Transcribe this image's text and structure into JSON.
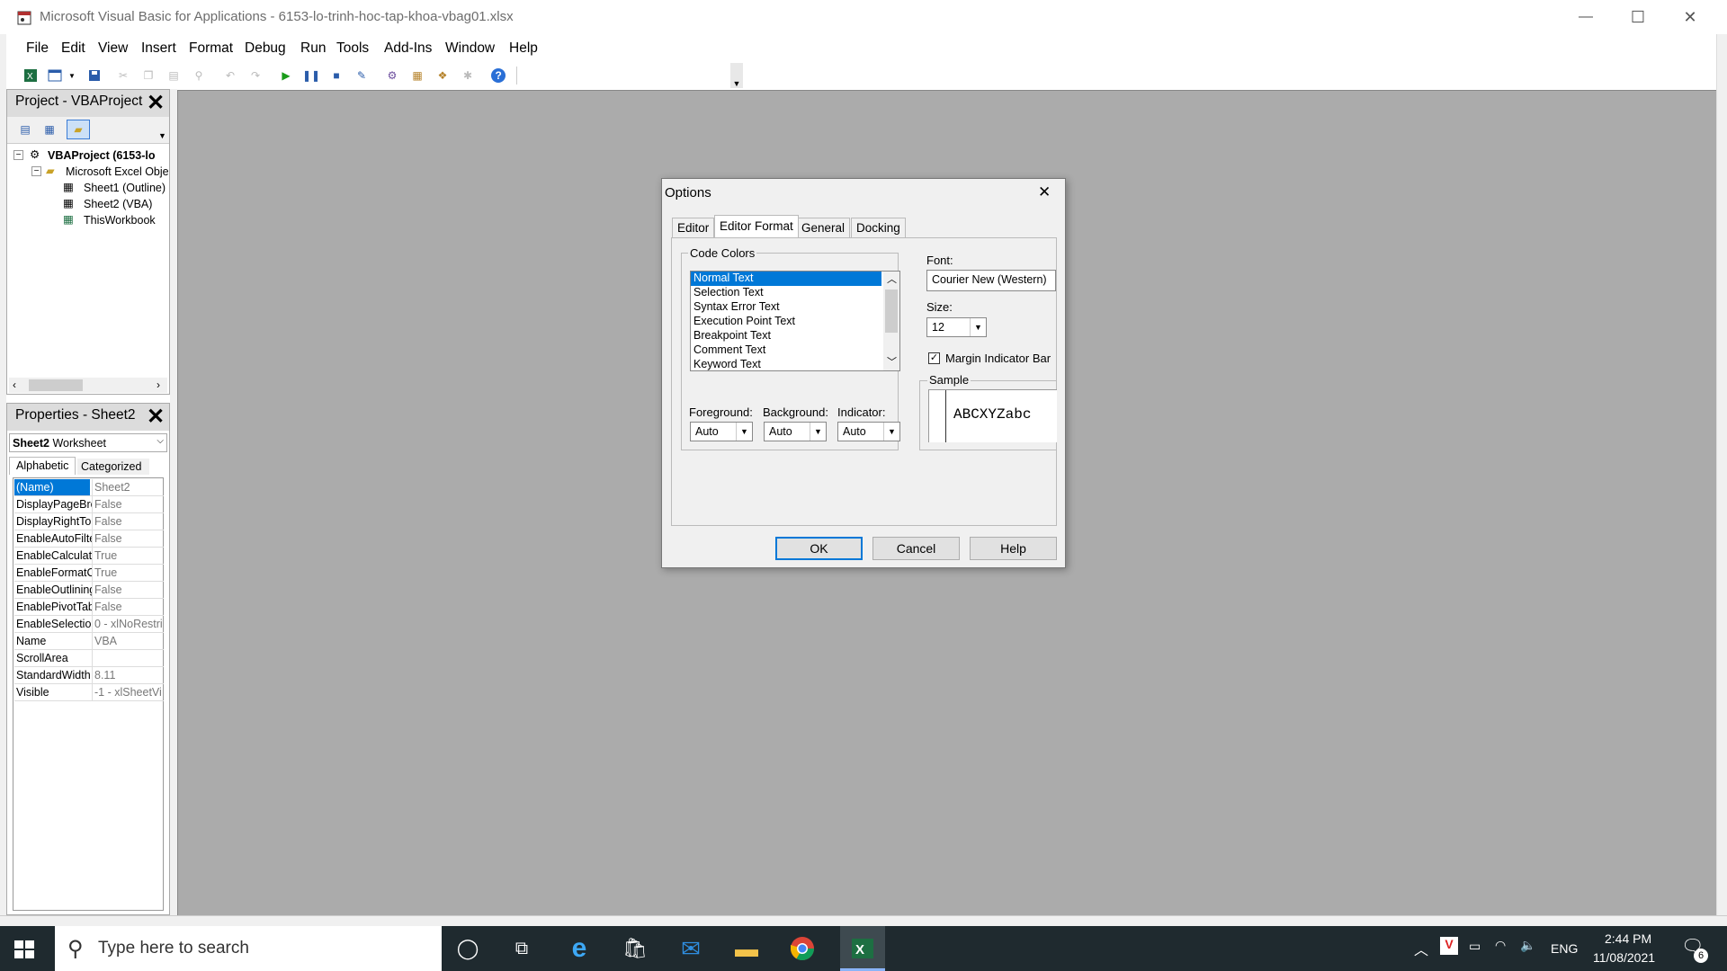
{
  "window": {
    "title": "Microsoft Visual Basic for Applications - 6153-lo-trinh-hoc-tap-khoa-vbag01.xlsx",
    "minimize": "—",
    "maximize": "☐",
    "close": "✕"
  },
  "menu": [
    "File",
    "Edit",
    "View",
    "Insert",
    "Format",
    "Debug",
    "Run",
    "Tools",
    "Add-Ins",
    "Window",
    "Help"
  ],
  "project_panel": {
    "title": "Project - VBAProject",
    "tree": [
      {
        "label": "VBAProject (6153-lo",
        "level": 0,
        "bold": true
      },
      {
        "label": "Microsoft Excel Obje",
        "level": 1,
        "bold": false
      },
      {
        "label": "Sheet1 (Outline)",
        "level": 2,
        "bold": false
      },
      {
        "label": "Sheet2 (VBA)",
        "level": 2,
        "bold": false
      },
      {
        "label": "ThisWorkbook",
        "level": 2,
        "bold": false
      }
    ]
  },
  "properties_panel": {
    "title": "Properties - Sheet2",
    "object_name": "Sheet2",
    "object_type": "Worksheet",
    "tabs": [
      "Alphabetic",
      "Categorized"
    ],
    "rows": [
      {
        "k": "(Name)",
        "v": "Sheet2"
      },
      {
        "k": "DisplayPageBre",
        "v": "False"
      },
      {
        "k": "DisplayRightTo",
        "v": "False"
      },
      {
        "k": "EnableAutoFilte",
        "v": "False"
      },
      {
        "k": "EnableCalculati",
        "v": "True"
      },
      {
        "k": "EnableFormatC",
        "v": "True"
      },
      {
        "k": "EnableOutlining",
        "v": "False"
      },
      {
        "k": "EnablePivotTab",
        "v": "False"
      },
      {
        "k": "EnableSelectio",
        "v": "0 - xlNoRestri"
      },
      {
        "k": "Name",
        "v": "VBA"
      },
      {
        "k": "ScrollArea",
        "v": ""
      },
      {
        "k": "StandardWidth",
        "v": "8.11"
      },
      {
        "k": "Visible",
        "v": "-1 - xlSheetVi"
      }
    ]
  },
  "dialog": {
    "title": "Options",
    "close": "✕",
    "tabs": [
      "Editor",
      "Editor Format",
      "General",
      "Docking"
    ],
    "active_tab": "Editor Format",
    "code_colors_label": "Code Colors",
    "code_colors": [
      "Normal Text",
      "Selection Text",
      "Syntax Error Text",
      "Execution Point Text",
      "Breakpoint Text",
      "Comment Text",
      "Keyword Text"
    ],
    "foreground_label": "Foreground:",
    "background_label": "Background:",
    "indicator_label": "Indicator:",
    "foreground_value": "Auto",
    "background_value": "Auto",
    "indicator_value": "Auto",
    "font_label": "Font:",
    "font_value": "Courier New (Western)",
    "size_label": "Size:",
    "size_value": "12",
    "margin_label": "Margin Indicator Bar",
    "sample_label": "Sample",
    "sample_text": "ABCXYZabc",
    "ok": "OK",
    "cancel": "Cancel",
    "help": "Help"
  },
  "taskbar": {
    "search_placeholder": "Type here to search",
    "language": "ENG",
    "time": "2:44 PM",
    "date": "11/08/2021",
    "notification_count": "6"
  },
  "colors": {
    "selection": "#0078d7",
    "workarea": "#ababab",
    "taskbar": "#1f2a2f"
  }
}
